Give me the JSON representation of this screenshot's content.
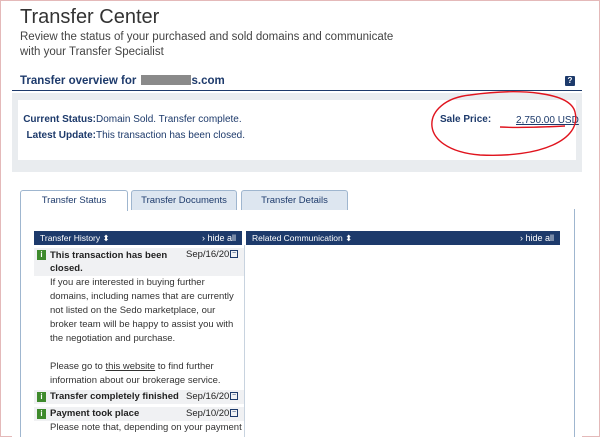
{
  "page": {
    "title": "Transfer Center",
    "subtitle": "Review the status of your purchased and sold domains and communicate with your Transfer Specialist"
  },
  "overview": {
    "heading_prefix": "Transfer overview for ",
    "heading_suffix": "s.com",
    "help": "?",
    "current_status_label": "Current Status:",
    "current_status_value": "Domain Sold. Transfer complete.",
    "latest_update_label": "Latest Update:",
    "latest_update_value": "This transaction has been closed.",
    "sale_price_label": "Sale Price:",
    "sale_price_value": "2,750.00 USD"
  },
  "tabs": [
    {
      "label": "Transfer Status"
    },
    {
      "label": "Transfer Documents"
    },
    {
      "label": "Transfer Details"
    }
  ],
  "history": {
    "header": "Transfer History ⬍",
    "hide": "hide all",
    "entries": [
      {
        "badge": "i",
        "title": "This transaction has been closed.",
        "date": "Sep/16/20",
        "toggle": "−",
        "body": "If you are interested in buying further domains, including names that are currently not listed on the Sedo marketplace, our broker team will be happy to assist you with the negotiation and purchase.",
        "body2_pre": "Please go to ",
        "body2_link": "this website",
        "body2_post": " to find further information about our brokerage service."
      },
      {
        "badge": "i",
        "title": "Transfer completely finished",
        "date": "Sep/16/20",
        "toggle": "−"
      },
      {
        "badge": "i",
        "title": "Payment took place",
        "date": "Sep/10/20",
        "toggle": "−",
        "body": "Please note that, depending on your payment"
      }
    ]
  },
  "communication": {
    "header": "Related Communication ⬍",
    "hide": "hide all"
  },
  "annotation_color": "#e0141e"
}
